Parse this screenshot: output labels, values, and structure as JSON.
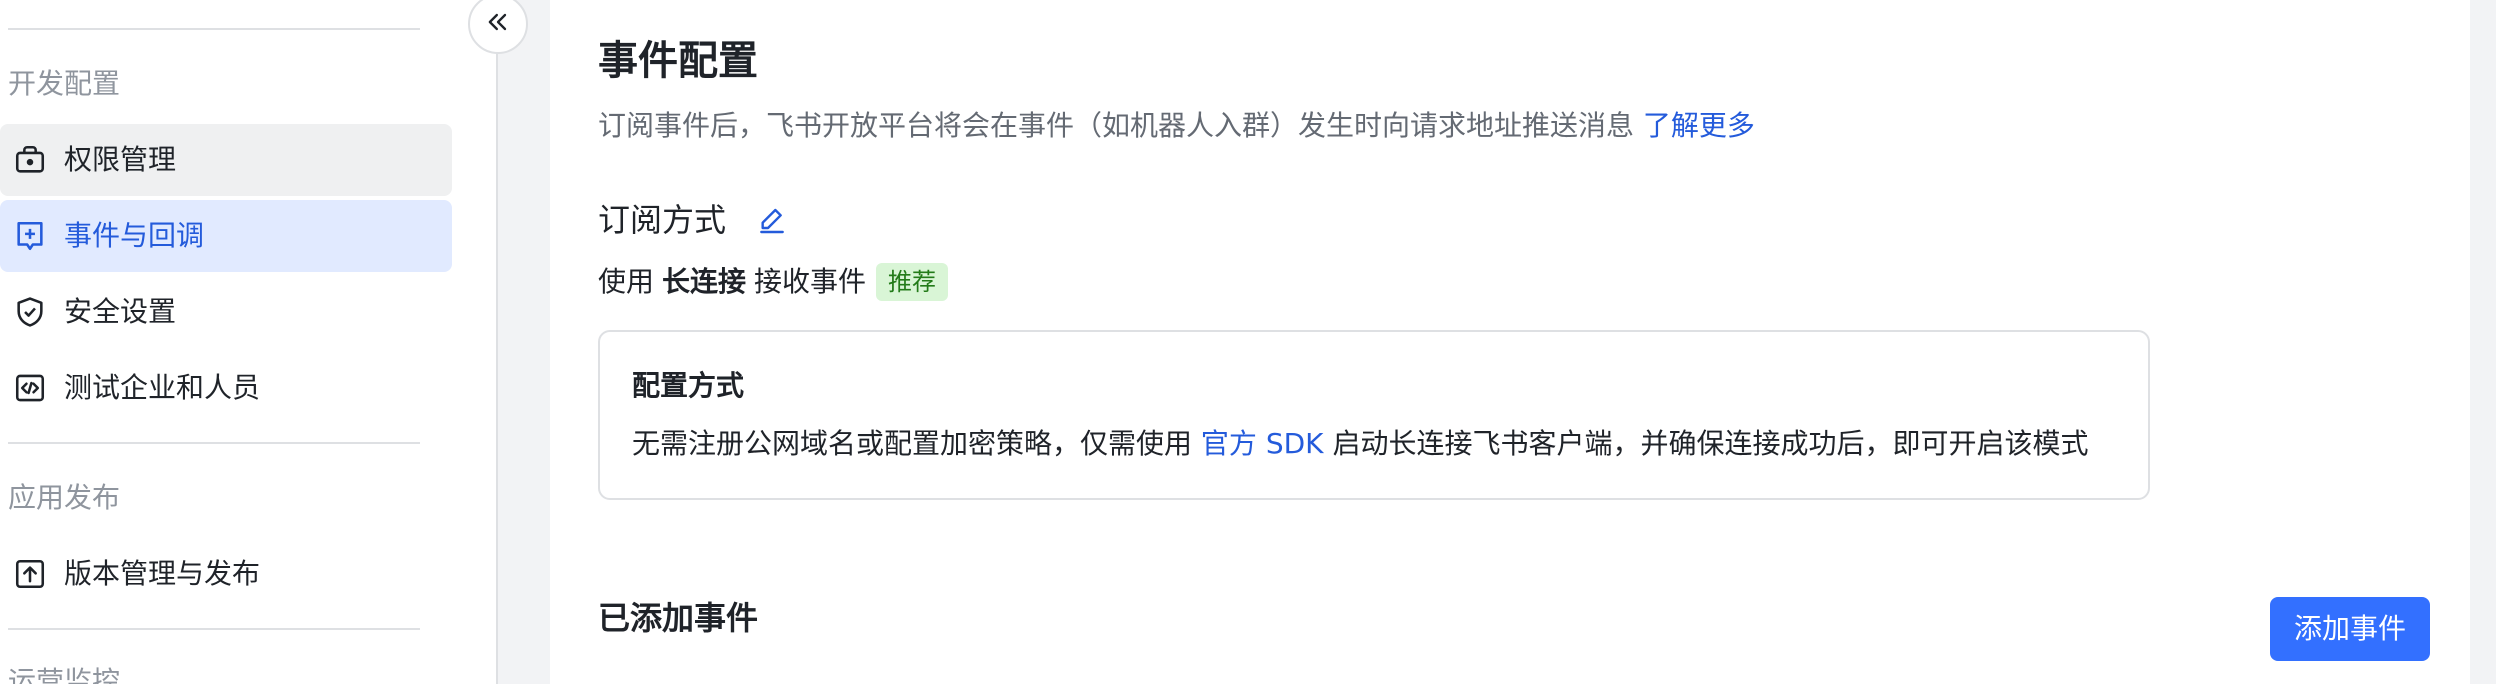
{
  "sidebar": {
    "sections": [
      {
        "title": "开发配置",
        "items": [
          {
            "label": "权限管理",
            "icon": "lock-box-icon"
          },
          {
            "label": "事件与回调",
            "icon": "event-plus-icon"
          },
          {
            "label": "安全设置",
            "icon": "shield-check-icon"
          },
          {
            "label": "测试企业和人员",
            "icon": "code-box-icon"
          }
        ]
      },
      {
        "title": "应用发布",
        "items": [
          {
            "label": "版本管理与发布",
            "icon": "upload-box-icon"
          }
        ]
      },
      {
        "title": "运营监控",
        "items": []
      }
    ],
    "active_item": "事件与回调",
    "collapse_icon": "double-chevron-left-icon"
  },
  "main": {
    "title": "事件配置",
    "description": "订阅事件后，飞书开放平台将会在事件（如机器人入群）发生时向请求地址推送消息",
    "learn_more": "了解更多",
    "subscription": {
      "title": "订阅方式",
      "edit_icon": "pencil-icon",
      "prefix": "使用",
      "method": "长连接",
      "suffix": "接收事件",
      "tag": "推荐"
    },
    "config_card": {
      "title": "配置方式",
      "text_before": "无需注册公网域名或配置加密策略，仅需使用",
      "link": "官方 SDK",
      "text_after": "启动长连接飞书客户端，并确保连接成功后，即可开启该模式"
    },
    "added_events": {
      "title": "已添加事件",
      "add_button": "添加事件"
    }
  },
  "colors": {
    "accent": "#3370ff",
    "link": "#245bdb",
    "active_bg": "#e1eaff",
    "tag_bg": "#d9f5d6",
    "tag_text": "#237b19"
  }
}
